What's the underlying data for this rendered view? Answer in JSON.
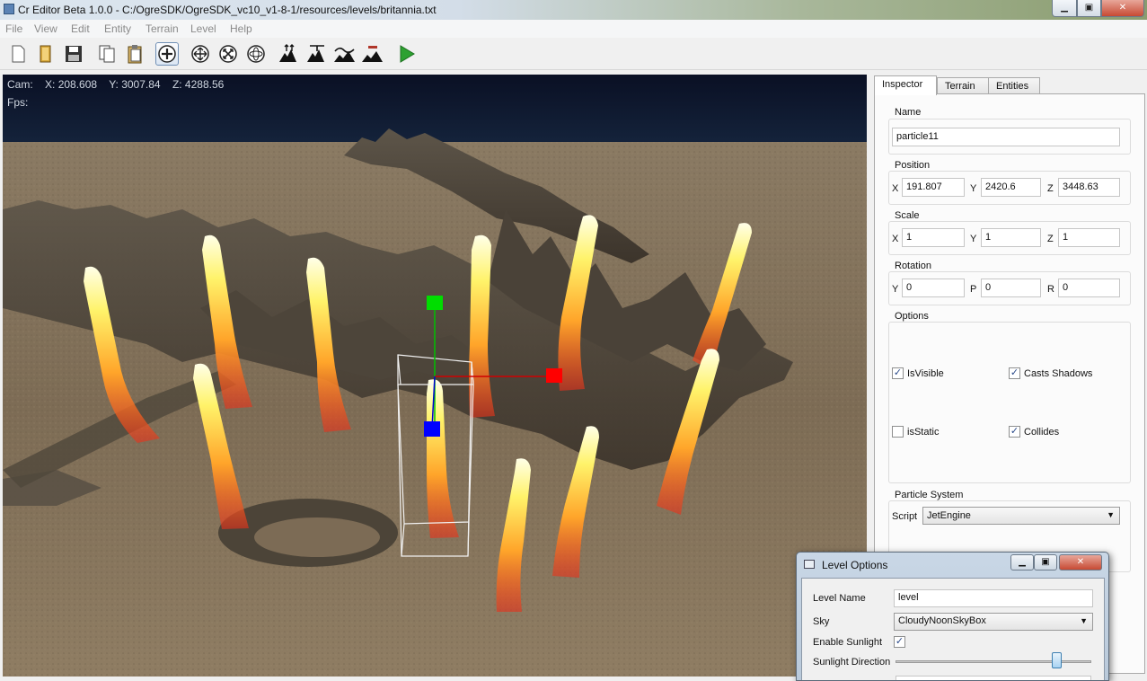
{
  "window": {
    "title": "Cr Editor Beta 1.0.0 - C:/OgreSDK/OgreSDK_vc10_v1-8-1/resources/levels/britannia.txt",
    "minimize": "▁",
    "maximize": "▣",
    "close": "✕"
  },
  "menu": [
    "File",
    "View",
    "Edit",
    "Entity",
    "Terrain",
    "Level",
    "Help"
  ],
  "toolbar": {
    "buttons": [
      "new-file-icon",
      "open-file-icon",
      "save-icon",
      "copy-icon",
      "paste-icon",
      "add-icon",
      "move-icon",
      "scale-icon",
      "rotate-icon",
      "terrain-raise-icon",
      "terrain-lower-icon",
      "terrain-smooth-icon",
      "terrain-flatten-icon",
      "play-icon"
    ],
    "active": "add-icon"
  },
  "viewport": {
    "cam_label": "Cam:",
    "cam_x": "X: 208.608",
    "cam_y": "Y: 3007.84",
    "cam_z": "Z: 4288.56",
    "fps_label": "Fps:"
  },
  "inspector": {
    "tabs": [
      "Inspector",
      "Terrain",
      "Entities"
    ],
    "name_label": "Name",
    "name_value": "particle11",
    "position_label": "Position",
    "position": {
      "x_label": "X",
      "x": "191.807",
      "y_label": "Y",
      "y": "2420.6",
      "z_label": "Z",
      "z": "3448.63"
    },
    "scale_label": "Scale",
    "scale": {
      "x_label": "X",
      "x": "1",
      "y_label": "Y",
      "y": "1",
      "z_label": "Z",
      "z": "1"
    },
    "rotation_label": "Rotation",
    "rotation": {
      "y_label": "Y",
      "y": "0",
      "p_label": "P",
      "p": "0",
      "r_label": "R",
      "r": "0"
    },
    "options_label": "Options",
    "options": {
      "is_visible": {
        "label": "IsVisible",
        "checked": true
      },
      "casts_shadows": {
        "label": "Casts Shadows",
        "checked": true
      },
      "is_static": {
        "label": "isStatic",
        "checked": false
      },
      "collides": {
        "label": "Collides",
        "checked": true
      }
    },
    "particle_system_label": "Particle System",
    "script_label": "Script",
    "script_value": "JetEngine"
  },
  "level_options": {
    "title": "Level Options",
    "level_name_label": "Level Name",
    "level_name_value": "level",
    "sky_label": "Sky",
    "sky_value": "CloudyNoonSkyBox",
    "enable_sunlight_label": "Enable Sunlight",
    "enable_sunlight_checked": true,
    "sunlight_direction_label": "Sunlight Direction",
    "sunlight_direction_fraction": 0.84
  },
  "colors": {
    "accent": "#3a6ea5",
    "close_red": "#c74a33",
    "gizmo_x": "#ff0000",
    "gizmo_y": "#00dd00",
    "gizmo_z": "#0000ff"
  }
}
